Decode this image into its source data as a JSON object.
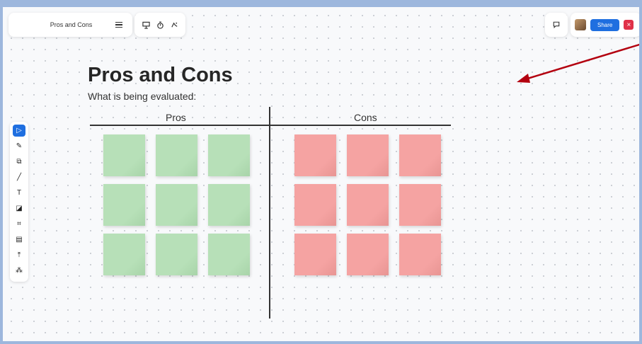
{
  "header": {
    "board_title": "Pros and Cons",
    "menu_icon": "hamburger-menu-icon",
    "tools": [
      "present-icon",
      "timer-icon",
      "reactions-icon"
    ],
    "comment_icon": "comment-icon",
    "share_label": "Share",
    "close_label": "×"
  },
  "toolbar": {
    "items": [
      "select",
      "pen",
      "shapes",
      "line",
      "text",
      "sticky-note",
      "frame",
      "template",
      "upload",
      "more"
    ],
    "glyphs": [
      "▷",
      "✎",
      "⧉",
      "╱",
      "T",
      "◪",
      "⌗",
      "▤",
      "⤒",
      "⁂"
    ]
  },
  "board": {
    "title": "Pros and Cons",
    "subtitle": "What is being evaluated:",
    "pros_label": "Pros",
    "cons_label": "Cons"
  },
  "colors": {
    "pros_note": "#b7e0b8",
    "cons_note": "#f5a3a2",
    "accent": "#1f6fe0",
    "arrow": "#b3000f"
  }
}
